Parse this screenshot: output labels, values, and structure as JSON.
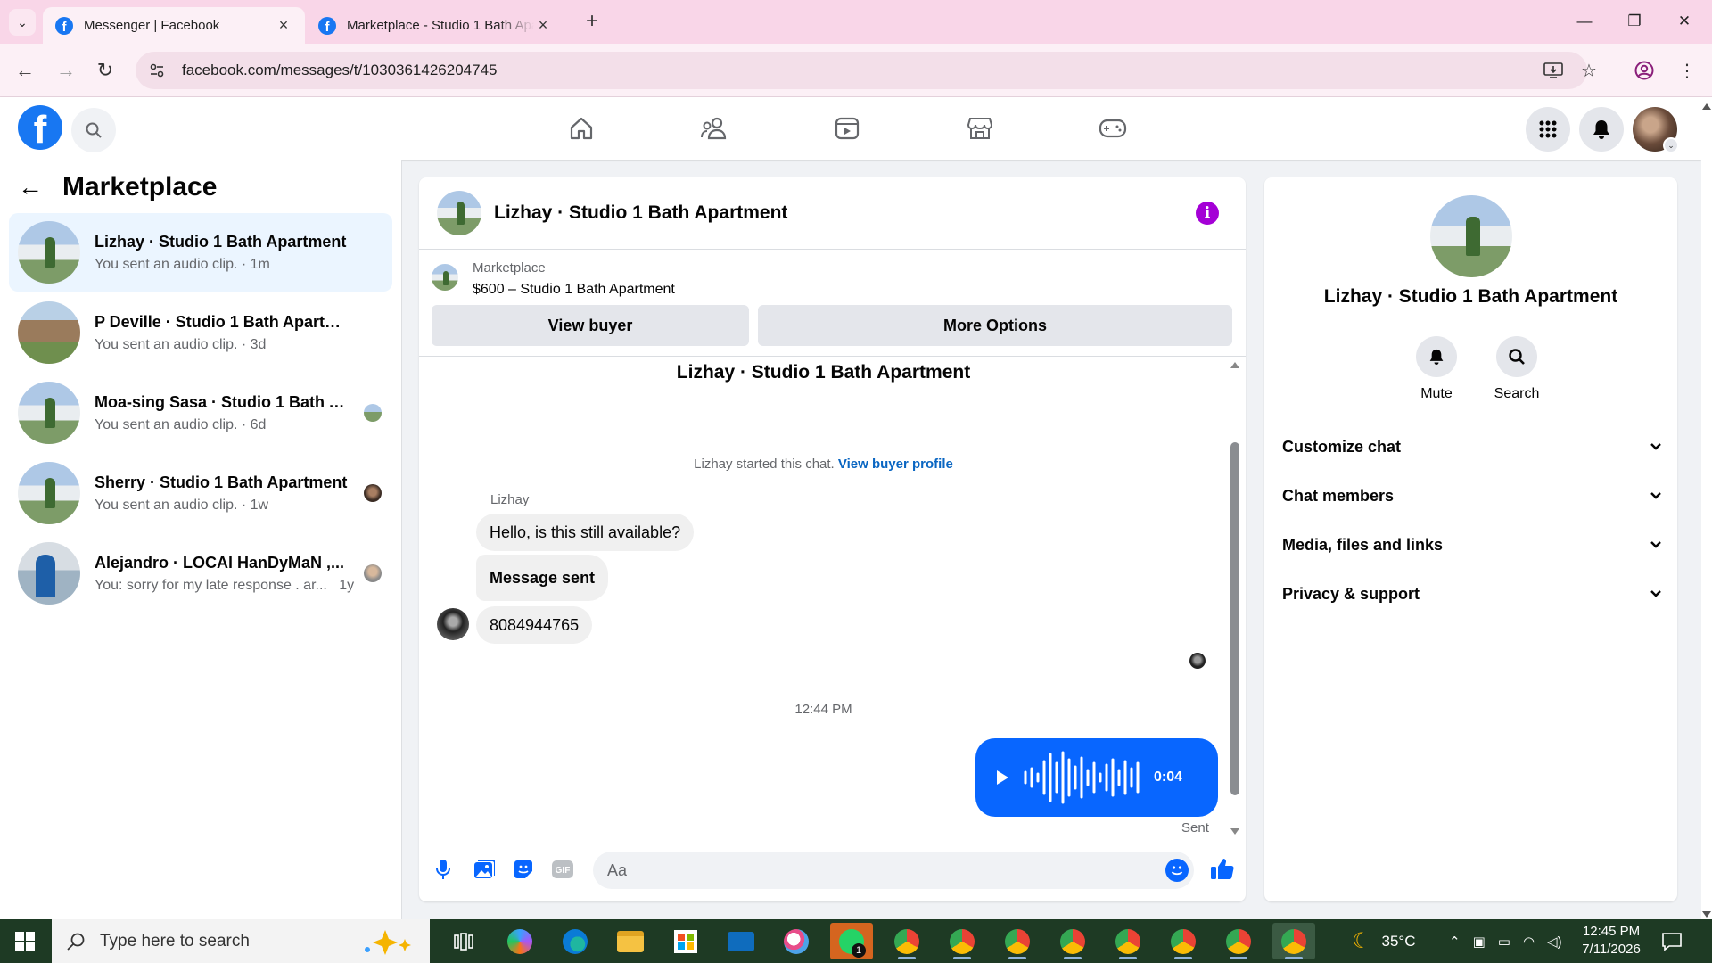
{
  "browser": {
    "tabs": [
      {
        "title": "Messenger | Facebook",
        "active": true
      },
      {
        "title": "Marketplace - Studio 1 Bath Apartment",
        "active": false
      }
    ],
    "url": "facebook.com/messages/t/1030361426204745"
  },
  "sidebar": {
    "title": "Marketplace",
    "chats": [
      {
        "name": "Lizhay · Studio 1 Bath Apartment",
        "preview": "You sent an audio clip.",
        "time": "1m",
        "active": true
      },
      {
        "name": "P Deville · Studio 1 Bath Apartment",
        "preview": "You sent an audio clip.",
        "time": "3d",
        "active": false
      },
      {
        "name": "Moa-sing Sasa · Studio 1 Bath A...",
        "preview": "You sent an audio clip.",
        "time": "6d",
        "active": false
      },
      {
        "name": "Sherry · Studio 1 Bath Apartment",
        "preview": "You sent an audio clip.",
        "time": "1w",
        "active": false
      },
      {
        "name": "Alejandro · LOCAl HanDyMaN ,...",
        "preview": "You: sorry for my late response . ar...",
        "time": "1y",
        "active": false
      }
    ]
  },
  "conversation": {
    "title": "Lizhay · Studio 1 Bath Apartment",
    "listing": {
      "source": "Marketplace",
      "price_title": "$600 – Studio 1 Bath Apartment",
      "view_buyer_label": "View buyer",
      "more_options_label": "More Options"
    },
    "thread_title": "Lizhay · Studio 1 Bath Apartment",
    "started_text": "Lizhay started this chat.",
    "started_link": "View buyer profile",
    "sender_name": "Lizhay",
    "messages": [
      {
        "text": "Hello, is this still available?",
        "bold": false
      },
      {
        "text": "Message sent",
        "bold": true
      },
      {
        "text": "8084944765",
        "bold": false
      }
    ],
    "timestamp": "12:44 PM",
    "audio": {
      "duration": "0:04",
      "status": "Sent"
    },
    "composer": {
      "placeholder": "Aa"
    }
  },
  "details": {
    "name": "Lizhay · Studio 1 Bath Apartment",
    "actions": [
      {
        "label": "Mute",
        "icon": "bell-icon"
      },
      {
        "label": "Search",
        "icon": "search-icon"
      }
    ],
    "sections": [
      {
        "label": "Customize chat"
      },
      {
        "label": "Chat members"
      },
      {
        "label": "Media, files and links"
      },
      {
        "label": "Privacy & support"
      }
    ]
  },
  "taskbar": {
    "search_placeholder": "Type here to search",
    "weather": "35°C",
    "time": "12:45 PM",
    "date": "7/11/2026",
    "whatsapp_badge": "1"
  },
  "colors": {
    "brand": "#1877f2",
    "messenger_blue": "#0866ff",
    "active_chat_bg": "#ebf5ff",
    "tabbar": "#f9d6e8",
    "taskbar": "#1e3a24",
    "info_purple": "#a400d6"
  }
}
